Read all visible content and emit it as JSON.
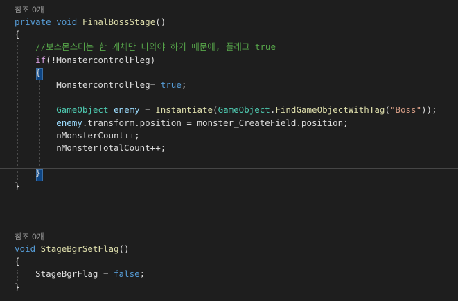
{
  "editor": {
    "methods": [
      {
        "codelens": "참조 0개",
        "lines": [
          [
            {
              "t": "private",
              "c": "kw"
            },
            {
              "t": " ",
              "c": "plain"
            },
            {
              "t": "void",
              "c": "kw"
            },
            {
              "t": " ",
              "c": "plain"
            },
            {
              "t": "FinalBossStage",
              "c": "method"
            },
            {
              "t": "()",
              "c": "plain"
            }
          ],
          [
            {
              "t": "{",
              "c": "plain"
            }
          ],
          [
            {
              "t": "    ",
              "c": "plain"
            },
            {
              "t": "//보스몬스터는 한 개체만 나와야 하기 때문에, 플래그 true",
              "c": "cm"
            }
          ],
          [
            {
              "t": "    ",
              "c": "plain"
            },
            {
              "t": "if",
              "c": "ctl"
            },
            {
              "t": "(!",
              "c": "plain"
            },
            {
              "t": "MonstercontrolFleg",
              "c": "plain"
            },
            {
              "t": ")",
              "c": "plain"
            }
          ],
          [
            {
              "t": "    ",
              "c": "plain"
            },
            {
              "t": "{",
              "c": "plain"
            }
          ],
          [
            {
              "t": "        ",
              "c": "plain"
            },
            {
              "t": "MonstercontrolFleg",
              "c": "plain"
            },
            {
              "t": "= ",
              "c": "plain"
            },
            {
              "t": "true",
              "c": "kw"
            },
            {
              "t": ";",
              "c": "plain"
            }
          ],
          [],
          [
            {
              "t": "        ",
              "c": "plain"
            },
            {
              "t": "GameObject",
              "c": "type"
            },
            {
              "t": " ",
              "c": "plain"
            },
            {
              "t": "enemy",
              "c": "var"
            },
            {
              "t": " = ",
              "c": "plain"
            },
            {
              "t": "Instantiate",
              "c": "method"
            },
            {
              "t": "(",
              "c": "plain"
            },
            {
              "t": "GameObject",
              "c": "type"
            },
            {
              "t": ".",
              "c": "plain"
            },
            {
              "t": "FindGameObjectWithTag",
              "c": "method"
            },
            {
              "t": "(",
              "c": "plain"
            },
            {
              "t": "\"Boss\"",
              "c": "str"
            },
            {
              "t": "));",
              "c": "plain"
            }
          ],
          [
            {
              "t": "        ",
              "c": "plain"
            },
            {
              "t": "enemy",
              "c": "var"
            },
            {
              "t": ".transform.position = monster_CreateField.position;",
              "c": "plain"
            }
          ],
          [
            {
              "t": "        ",
              "c": "plain"
            },
            {
              "t": "nMonsterCount++;",
              "c": "plain"
            }
          ],
          [
            {
              "t": "        ",
              "c": "plain"
            },
            {
              "t": "nMonsterTotalCount++;",
              "c": "plain"
            }
          ],
          [],
          [
            {
              "t": "    ",
              "c": "plain"
            },
            {
              "t": "}",
              "c": "plain"
            }
          ],
          [
            {
              "t": "}",
              "c": "plain"
            }
          ]
        ]
      },
      {
        "codelens": "참조 0개",
        "lines": [
          [
            {
              "t": "void",
              "c": "kw"
            },
            {
              "t": " ",
              "c": "plain"
            },
            {
              "t": "StageBgrSetFlag",
              "c": "method"
            },
            {
              "t": "()",
              "c": "plain"
            }
          ],
          [
            {
              "t": "{",
              "c": "plain"
            }
          ],
          [
            {
              "t": "    ",
              "c": "plain"
            },
            {
              "t": "StageBgrFlag = ",
              "c": "plain"
            },
            {
              "t": "false",
              "c": "kw"
            },
            {
              "t": ";",
              "c": "plain"
            }
          ],
          [
            {
              "t": "}",
              "c": "plain"
            }
          ]
        ]
      }
    ]
  }
}
